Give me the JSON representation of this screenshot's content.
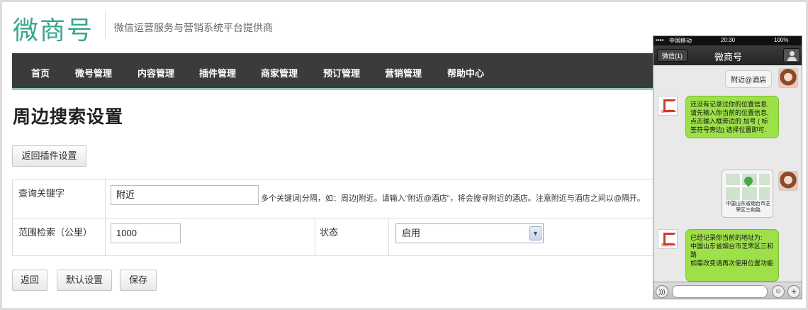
{
  "header": {
    "logo_text": "微商号",
    "slogan": "微信运营服务与营销系统平台提供商"
  },
  "nav": {
    "items": [
      "首页",
      "微号管理",
      "内容管理",
      "插件管理",
      "商家管理",
      "预订管理",
      "营销管理",
      "帮助中心"
    ]
  },
  "page": {
    "title": "周边搜索设置",
    "back_plugin_button": "返回插件设置"
  },
  "form": {
    "keyword_label": "查询关键字",
    "keyword_value": "附近",
    "keyword_hint": "多个关键词|分隔，如：周边|附近。请输入\"附近@酒店\"，将会搜寻附近的酒店。注意附近与酒店之间以@隔开。",
    "range_label": "范围检索（公里）",
    "range_value": "1000",
    "status_label": "状态",
    "status_value": "启用"
  },
  "actions": {
    "back": "返回",
    "default": "默认设置",
    "save": "保存"
  },
  "phone": {
    "carrier": "中国移动",
    "time": "20:30",
    "battery": "100%",
    "back_label": "微信(1)",
    "title": "微商号",
    "msg_user_1": "附近@酒店",
    "msg_bot_1": "还没有记录过你的位置信息,请先输入你当前的位置信息,\n点击输入框旁边的 加号 ( 标签符号旁边) 选择位置即可.",
    "map_caption": "中国山东省烟台市芝罘区三和路",
    "msg_bot_2": "已经记录你当前的地址为:\n中国山东省烟台市芝罘区三和路\n如需改变请再次使用位置功能",
    "logo_small": "微商号"
  }
}
